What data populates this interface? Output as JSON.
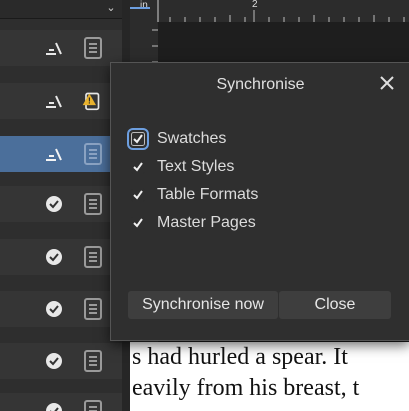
{
  "dialog": {
    "title": "Synchronise",
    "options": [
      {
        "label": "Swatches",
        "checked": true
      },
      {
        "label": "Text Styles",
        "checked": true
      },
      {
        "label": "Table Formats",
        "checked": true
      },
      {
        "label": "Master Pages",
        "checked": true
      }
    ],
    "sync_button": "Synchronise now",
    "close_button": "Close"
  },
  "ruler": {
    "unit": "in",
    "mark": "2"
  },
  "document": {
    "line1": "s had hurled a spear. It",
    "line2": "eavily from his breast, t"
  },
  "resource_rows": [
    {
      "action_icon": "edit-sync-icon",
      "status_icon": "document-icon"
    },
    {
      "action_icon": "edit-sync-icon",
      "status_icon": "warning-document-icon"
    },
    {
      "action_icon": "edit-sync-icon",
      "status_icon": "document-icon",
      "selected": true
    },
    {
      "action_icon": "synced-check-icon",
      "status_icon": "document-icon"
    },
    {
      "action_icon": "synced-check-icon",
      "status_icon": "document-icon"
    },
    {
      "action_icon": "synced-check-icon",
      "status_icon": "document-icon"
    },
    {
      "action_icon": "synced-check-icon",
      "status_icon": "document-icon"
    },
    {
      "action_icon": "synced-check-icon",
      "status_icon": "document-icon"
    }
  ],
  "colors": {
    "accent": "#6d9fe0",
    "selected_row": "#4b6f9b",
    "warning": "#e8b22e",
    "dialog_bg": "#2f2f2f"
  }
}
